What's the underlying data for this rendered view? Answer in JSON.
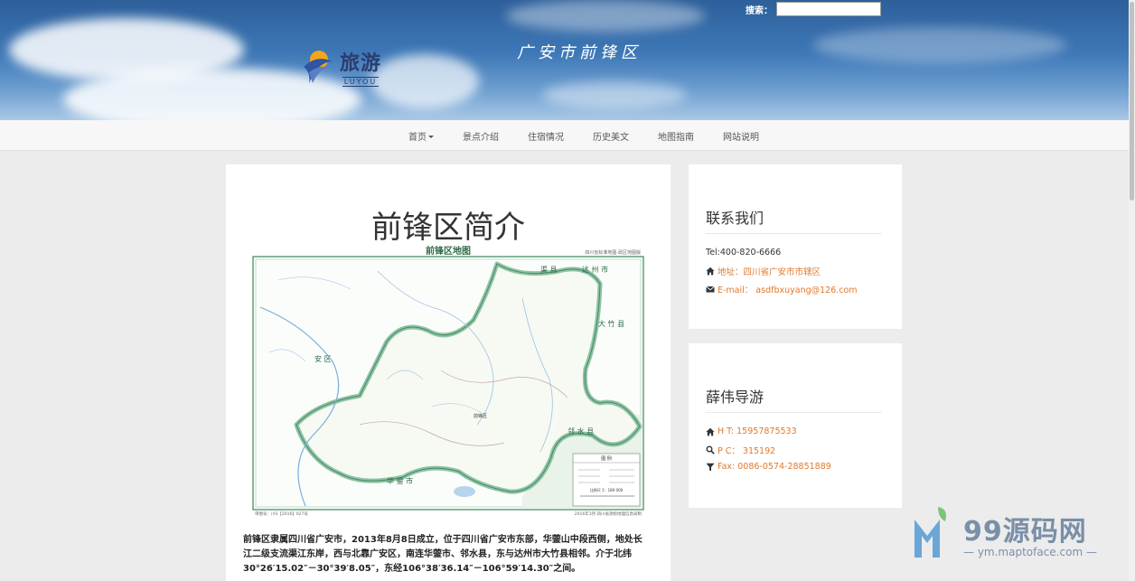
{
  "header": {
    "search_label": "搜索：",
    "search_value": "",
    "logo_cn": "旅游",
    "logo_en": "LUYOU",
    "site_name": "广安市前锋区"
  },
  "nav": {
    "items": [
      {
        "label": "首页",
        "has_caret": true
      },
      {
        "label": "景点介绍"
      },
      {
        "label": "住宿情况"
      },
      {
        "label": "历史美文"
      },
      {
        "label": "地图指南"
      },
      {
        "label": "网站说明"
      }
    ]
  },
  "article": {
    "title": "前锋区简介",
    "map": {
      "title": "前锋区地图",
      "source_note": "四川省标准地图·政区地图版",
      "labels": {
        "qu_county": "渠 县",
        "dazhou": "达 州 市",
        "dazhu": "大 竹 县",
        "guangan": "安 区",
        "linshui": "邻 水 县",
        "huaying": "华 蓥 市",
        "qianfeng": "前锋区"
      },
      "legend_title": "图    例",
      "scale_text": "比例尺 1：180 000",
      "map_number": "审图号：川S【2016】027号",
      "publish_note": "2016年3月  四川省测绘地理信息局制"
    },
    "body": "前锋区隶属四川省广安市，2013年8月8日成立，位于四川省广安市东部，华蓥山中段西侧，地处长江二级支流渠江东岸，西与北靠广安区，南连华蓥市、邻水县，东与达州市大竹县相邻。介于北纬30°26′15.02″－30°39′8.05″，东经106°38′36.14″－106°59′14.30″之间。"
  },
  "sidebar": {
    "contact": {
      "title": "联系我们",
      "tel": "Tel:400-820-6666",
      "address": "地址：四川省广安市市辖区",
      "email": "E-mail： asdfbxuyang@126.com"
    },
    "guide": {
      "title": "薛伟导游",
      "ht": "H T: 15957875533",
      "pc": "P C： 315192",
      "fax": "Fax: 0086-0574-28851889"
    }
  },
  "watermark": {
    "text": "99源码网",
    "url": "— ym.maptoface.com —"
  },
  "colors": {
    "accent": "#e0782a",
    "page_bg": "#ececec",
    "nav_bg": "#f7f7f7",
    "map_border": "#6fae8a"
  }
}
